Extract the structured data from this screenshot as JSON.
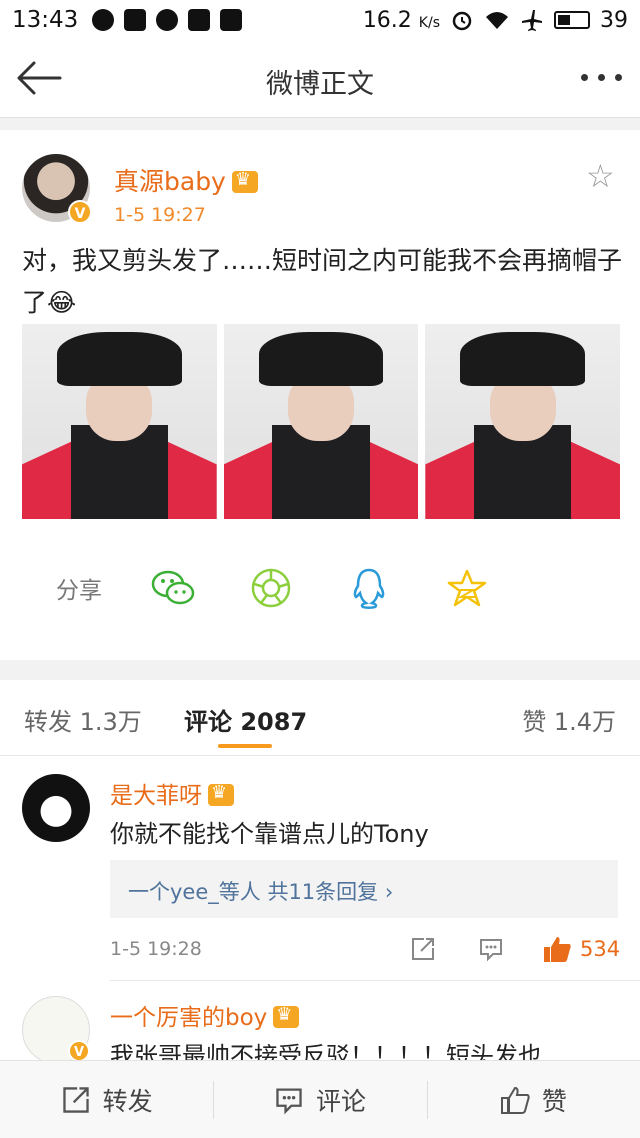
{
  "status_bar": {
    "time": "13:43",
    "speed_value": "16.2",
    "speed_unit": "K/s",
    "battery": "39",
    "icons": [
      "app-notification-icon",
      "weibo-icon",
      "chat-icon",
      "mail-icon",
      "shield-icon",
      "alarm-icon",
      "wifi-icon",
      "airplane-icon",
      "battery-icon"
    ]
  },
  "nav": {
    "title": "微博正文",
    "back_icon": "back-arrow-icon",
    "more_icon": "more-dots-icon"
  },
  "post": {
    "author": "真源baby",
    "time": "1-5 19:27",
    "text": "对，我又剪头发了……短时间之内可能我不会再摘帽子了😂",
    "photos": [
      "photo-1",
      "photo-2",
      "photo-3"
    ],
    "verified_badge": "V",
    "share_label": "分享",
    "share_targets": [
      "wechat-icon",
      "moments-icon",
      "qq-icon",
      "qzone-icon"
    ]
  },
  "tabs": {
    "repost": "转发 1.3万",
    "comment": "评论 2087",
    "like": "赞 1.4万"
  },
  "comments": [
    {
      "name": "是大菲呀",
      "text": "你就不能找个靠谱点儿的Tony",
      "reply_summary": "一个yee_等人  共11条回复 ›",
      "time": "1-5 19:28",
      "likes": "534"
    },
    {
      "name": "一个厉害的boy",
      "text": "我张哥最帅不接受反驳！！！！短头发也",
      "verified_badge": "V"
    }
  ],
  "bottom_bar": {
    "repost": "转发",
    "comment": "评论",
    "like": "赞"
  },
  "colors": {
    "accent_orange": "#e86c1a",
    "link_blue": "#50739c",
    "tab_underline": "#f79a1e",
    "wechat_green": "#3cb034",
    "qq_blue": "#2a9bd8",
    "qzone_yellow": "#f5c20a"
  }
}
